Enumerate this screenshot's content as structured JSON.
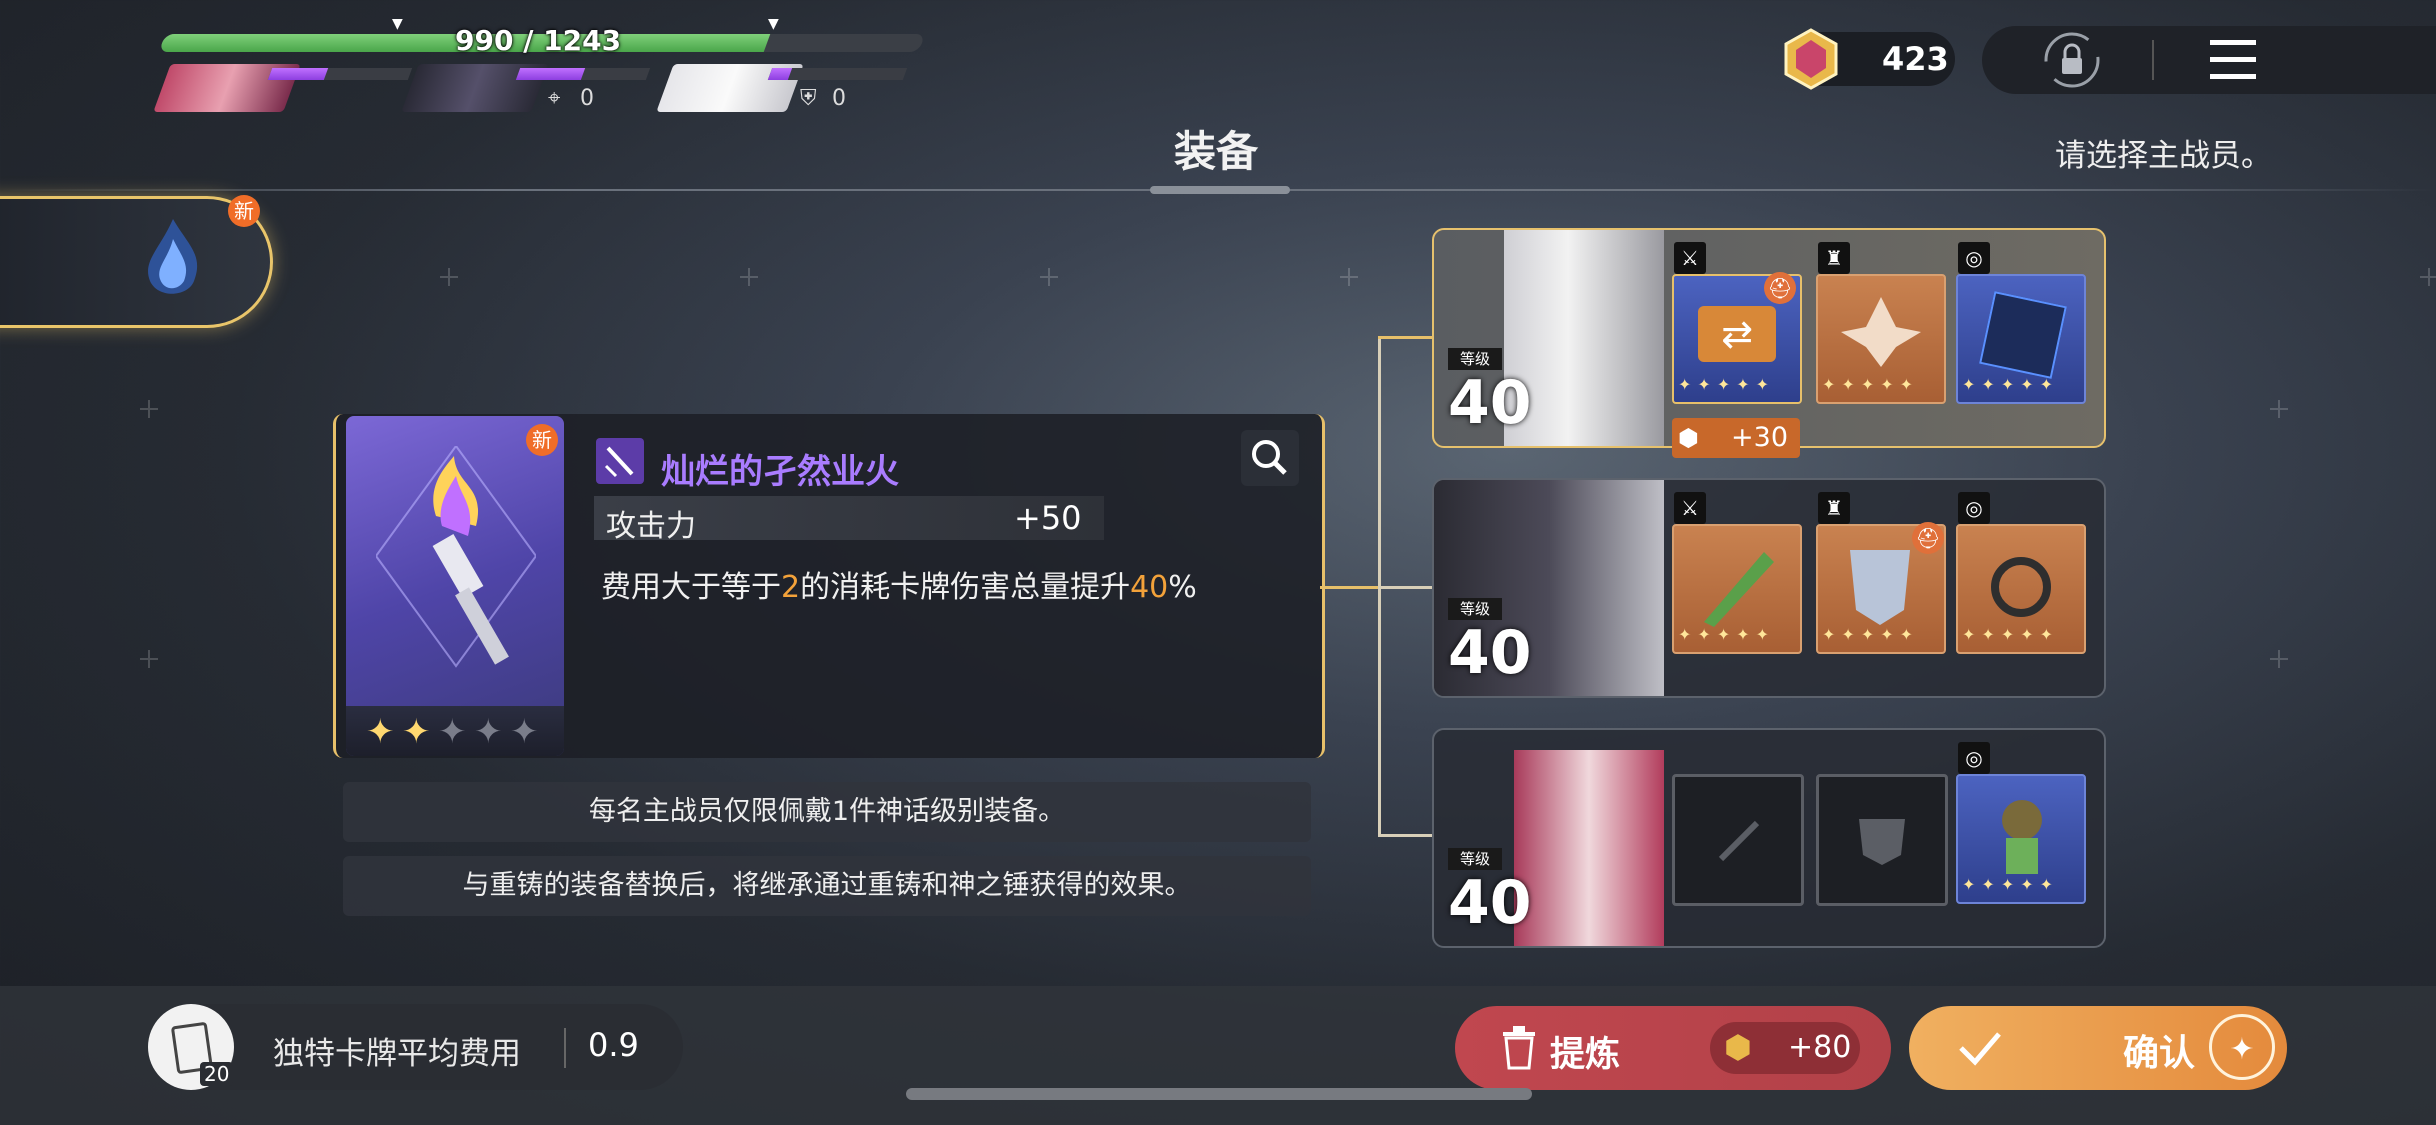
{
  "party": {
    "hp_text": "990 / 1243",
    "hp_fraction": 0.796,
    "stat_a": "0",
    "stat_b": "0"
  },
  "currency": {
    "amount": "423"
  },
  "header": {
    "title": "装备",
    "hint": "请选择主战员。"
  },
  "deck_tab": {
    "badge": "新"
  },
  "equipment": {
    "badge": "新",
    "name": "灿烂的孑然业火",
    "stat_label": "攻击力",
    "stat_value": "+50",
    "desc_before": "费用大于等于",
    "desc_num1": "2",
    "desc_mid": "的消耗卡牌伤害总量提升",
    "desc_num2": "40",
    "desc_after": "%",
    "rarity_stars": 2,
    "rarity_max": 5
  },
  "notices": [
    "每名主战员仅限佩戴1件神话级别装备。",
    "与重铸的装备替换后，将继承通过重铸和神之锤获得的效果。"
  ],
  "characters": [
    {
      "level_label": "等级",
      "level": "40",
      "bonus": "+30"
    },
    {
      "level_label": "等级",
      "level": "40"
    },
    {
      "level_label": "等级",
      "level": "40"
    }
  ],
  "bottom": {
    "deck_count": "20",
    "avg_cost_label": "独特卡牌平均费用",
    "avg_cost_value": "0.9",
    "refine_label": "提炼",
    "refine_reward": "+80",
    "confirm_label": "确认"
  },
  "colors": {
    "gold": "#e7c06a",
    "purple": "#a97cff",
    "accent_orange": "#f3a23a",
    "refine": "#b24148",
    "confirm": "#e48a3c"
  }
}
